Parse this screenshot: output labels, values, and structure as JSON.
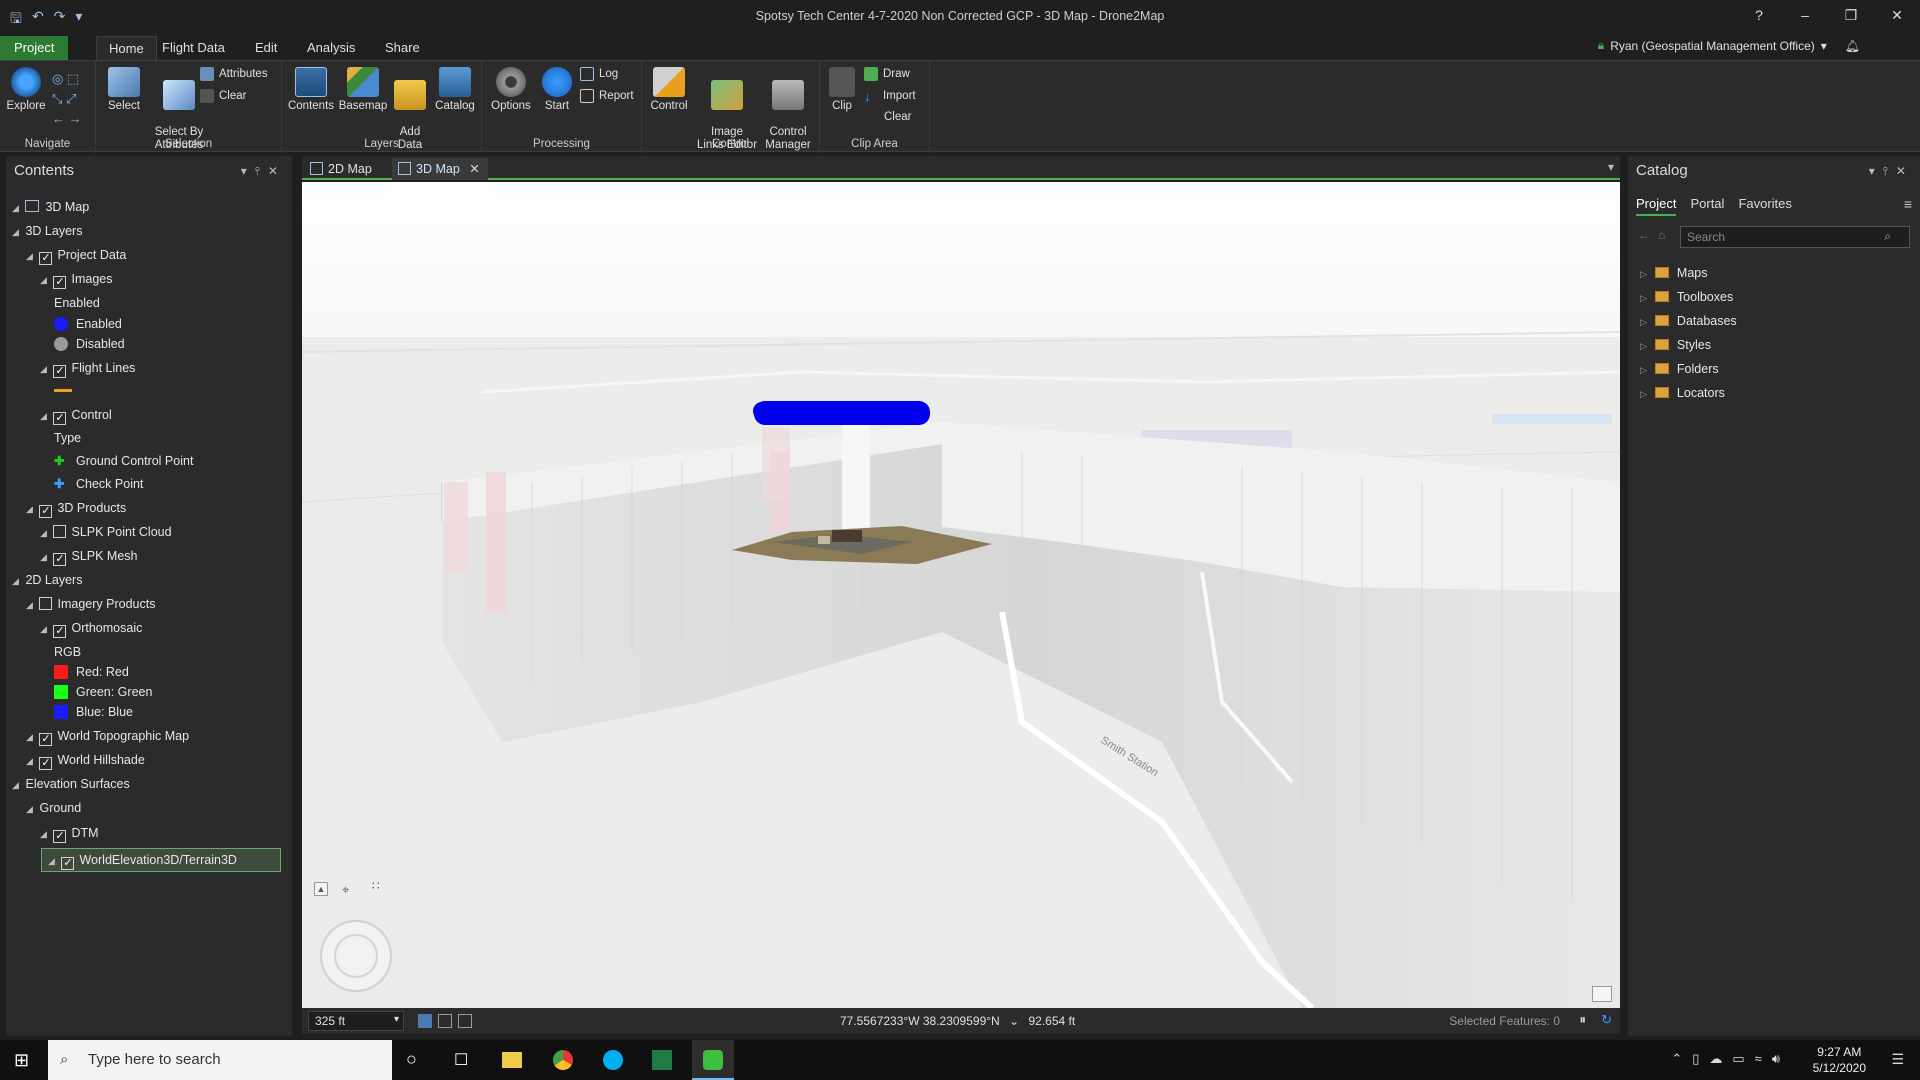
{
  "window": {
    "title": "Spotsy Tech Center 4-7-2020 Non Corrected GCP - 3D Map - Drone2Map",
    "help": "?"
  },
  "ribbon_tabs": [
    "Project",
    "Home",
    "Flight Data",
    "Edit",
    "Analysis",
    "Share"
  ],
  "user": "Ryan (Geospatial Management Office)",
  "ribbon": {
    "navigate": {
      "explore": "Explore",
      "group": "Navigate"
    },
    "selection": {
      "select": "Select",
      "select_by_attributes": "Select By\nAttributes",
      "attributes": "Attributes",
      "clear": "Clear",
      "group": "Selection"
    },
    "layers": {
      "contents": "Contents",
      "basemap": "Basemap",
      "add_data": "Add\nData",
      "catalog": "Catalog",
      "group": "Layers"
    },
    "processing": {
      "options": "Options",
      "start": "Start",
      "log": "Log",
      "report": "Report",
      "group": "Processing"
    },
    "control": {
      "control": "Control",
      "image_links_editor": "Image\nLinks Editor",
      "control_manager": "Control\nManager",
      "group": "Control"
    },
    "clip_area": {
      "clip": "Clip",
      "draw": "Draw",
      "import": "Import",
      "clear": "Clear",
      "group": "Clip Area"
    }
  },
  "contents": {
    "title": "Contents",
    "items": [
      {
        "label": "3D Map",
        "level": 0,
        "type": "map"
      },
      {
        "label": "3D Layers",
        "level": 0,
        "type": "group"
      },
      {
        "label": "Project Data",
        "level": 1,
        "type": "check",
        "checked": true
      },
      {
        "label": "Images",
        "level": 2,
        "type": "check",
        "checked": true
      },
      {
        "label": "Enabled",
        "level": 3,
        "type": "text"
      },
      {
        "label": "Enabled",
        "level": 3,
        "type": "swatch",
        "color": "#1a1aff",
        "round": true
      },
      {
        "label": "Disabled",
        "level": 3,
        "type": "swatch",
        "color": "#9a9a9a",
        "round": true
      },
      {
        "label": "Flight Lines",
        "level": 2,
        "type": "check",
        "checked": true
      },
      {
        "label": "",
        "level": 3,
        "type": "line",
        "color": "#f0a020"
      },
      {
        "label": "Control",
        "level": 2,
        "type": "check",
        "checked": true
      },
      {
        "label": "Type",
        "level": 3,
        "type": "text"
      },
      {
        "label": "Ground Control Point",
        "level": 3,
        "type": "plus",
        "color": "#22cc22"
      },
      {
        "label": "Check Point",
        "level": 3,
        "type": "plus",
        "color": "#3aa0ff"
      },
      {
        "label": "3D Products",
        "level": 1,
        "type": "check",
        "checked": true
      },
      {
        "label": "SLPK Point Cloud",
        "level": 2,
        "type": "check",
        "checked": false
      },
      {
        "label": "SLPK Mesh",
        "level": 2,
        "type": "check",
        "checked": true
      },
      {
        "label": "2D Layers",
        "level": 0,
        "type": "group"
      },
      {
        "label": "Imagery Products",
        "level": 1,
        "type": "check",
        "checked": false
      },
      {
        "label": "Orthomosaic",
        "level": 2,
        "type": "check",
        "checked": true
      },
      {
        "label": "RGB",
        "level": 3,
        "type": "text"
      },
      {
        "label": "Red:   Red",
        "level": 3,
        "type": "swatch",
        "color": "#ff1a1a"
      },
      {
        "label": "Green: Green",
        "level": 3,
        "type": "swatch",
        "color": "#1aff1a"
      },
      {
        "label": "Blue:  Blue",
        "level": 3,
        "type": "swatch",
        "color": "#1a1aff"
      },
      {
        "label": "World Topographic Map",
        "level": 1,
        "type": "check",
        "checked": true
      },
      {
        "label": "World Hillshade",
        "level": 1,
        "type": "check",
        "checked": true
      },
      {
        "label": "Elevation Surfaces",
        "level": 0,
        "type": "group"
      },
      {
        "label": "Ground",
        "level": 1,
        "type": "group"
      },
      {
        "label": "DTM",
        "level": 2,
        "type": "check",
        "checked": true
      },
      {
        "label": "WorldElevation3D/Terrain3D",
        "level": 2,
        "type": "check",
        "checked": true,
        "selected": true
      }
    ]
  },
  "view_tabs": [
    {
      "label": "2D Map",
      "active": false
    },
    {
      "label": "3D Map",
      "active": true
    }
  ],
  "map": {
    "road_label": "Smith Station",
    "scale": "325 ft",
    "coords": "77.5567233°W 38.2309599°N",
    "elevation": "92.654 ft",
    "selected_features": "Selected Features: 0"
  },
  "catalog": {
    "title": "Catalog",
    "tabs": [
      "Project",
      "Portal",
      "Favorites"
    ],
    "search_placeholder": "Search",
    "items": [
      "Maps",
      "Toolboxes",
      "Databases",
      "Styles",
      "Folders",
      "Locators"
    ]
  },
  "taskbar": {
    "search_placeholder": "Type here to search",
    "time": "9:27 AM",
    "date": "5/12/2020"
  },
  "colors": {
    "accent": "#4caf50",
    "project_tab": "#2d7a32",
    "flight_points": "#0000ee"
  }
}
